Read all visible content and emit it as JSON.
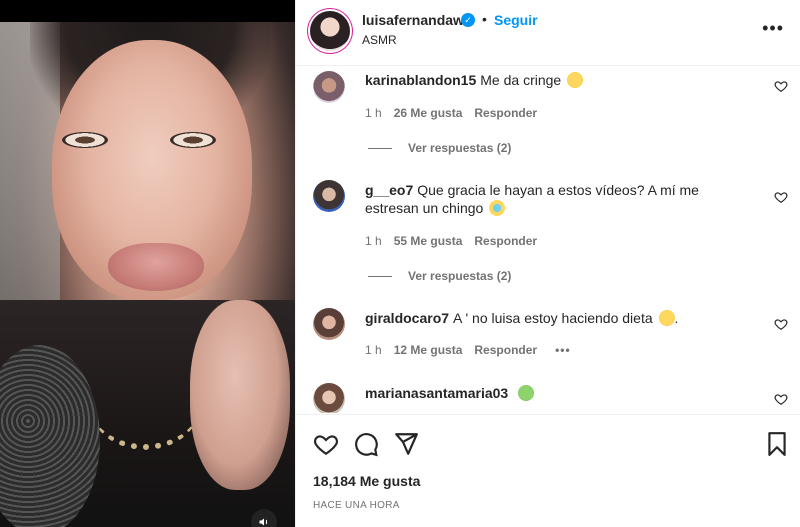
{
  "post": {
    "username": "luisafernandaw",
    "verified": true,
    "separator": "•",
    "follow_label": "Seguir",
    "subtitle": "ASMR",
    "more_label": "•••",
    "likes": "18,184 Me gusta",
    "timestamp": "HACE UNA HORA"
  },
  "comments": [
    {
      "user": "karinablandon15",
      "text": "Me da cringe",
      "emoji": "sad-face",
      "time": "1 h",
      "likes": "26 Me gusta",
      "reply": "Responder",
      "view_replies": "Ver respuestas (2)"
    },
    {
      "user": "g__eo7",
      "text": "Que gracia le hayan a estos vídeos? A mí me estresan un chingo",
      "emoji": "crying-face",
      "time": "1 h",
      "likes": "55 Me gusta",
      "reply": "Responder",
      "view_replies": "Ver respuestas (2)"
    },
    {
      "user": "giraldocaro7",
      "text": "A ' no luisa estoy haciendo dieta",
      "emoji": "sad-face",
      "text_suffix": ".",
      "time": "1 h",
      "likes": "12 Me gusta",
      "reply": "Responder",
      "more": "•••"
    },
    {
      "user": "marianasantamaria03",
      "text": "",
      "emoji": "nauseated-face"
    }
  ],
  "icons": {
    "like": "heart-icon",
    "comment": "comment-icon",
    "share": "send-icon",
    "save": "bookmark-icon",
    "sound": "speaker-icon"
  },
  "colors": {
    "link": "#0095f6",
    "text": "#262626",
    "muted": "#737373",
    "border": "#efefef"
  }
}
